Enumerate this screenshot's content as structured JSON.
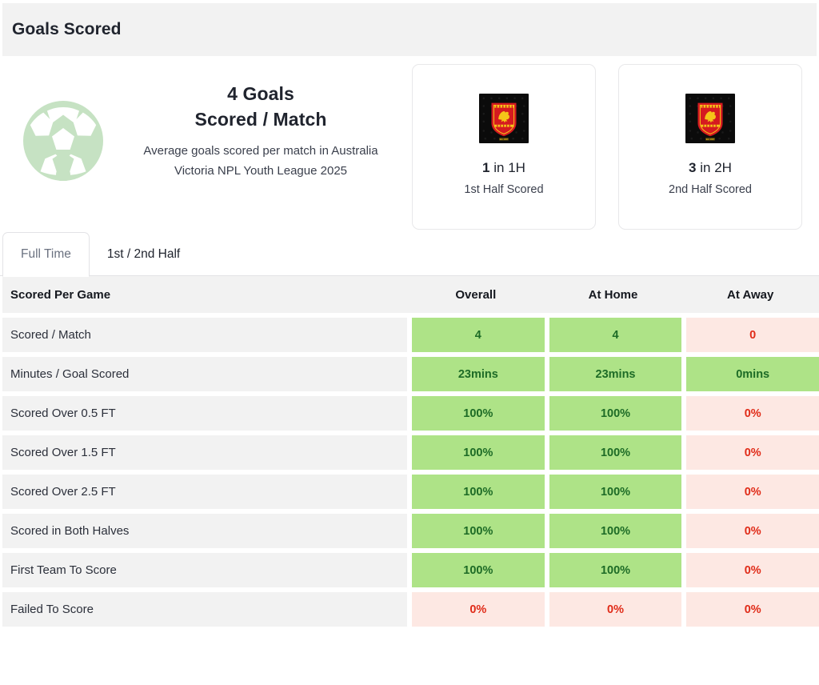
{
  "header": {
    "title": "Goals Scored"
  },
  "hero": {
    "icon": "soccer-ball-icon",
    "headline_line1": "4 Goals",
    "headline_line2": "Scored / Match",
    "description": "Average goals scored per match in Australia Victoria NPL Youth League 2025",
    "cards": [
      {
        "crest": "team-crest-icon",
        "value_number": "1",
        "value_suffix": " in 1H",
        "label": "1st Half Scored"
      },
      {
        "crest": "team-crest-icon",
        "value_number": "3",
        "value_suffix": " in 2H",
        "label": "2nd Half Scored"
      }
    ]
  },
  "tabs": {
    "items": [
      {
        "label": "Full Time",
        "active": true
      },
      {
        "label": "1st / 2nd Half",
        "active": false
      }
    ]
  },
  "table": {
    "columns": [
      "Scored Per Game",
      "Overall",
      "At Home",
      "At Away"
    ],
    "rows": [
      {
        "label": "Scored / Match",
        "values": [
          "4",
          "4",
          "0"
        ],
        "states": [
          "good",
          "good",
          "bad"
        ]
      },
      {
        "label": "Minutes / Goal Scored",
        "values": [
          "23mins",
          "23mins",
          "0mins"
        ],
        "states": [
          "good",
          "good",
          "good"
        ]
      },
      {
        "label": "Scored Over 0.5 FT",
        "values": [
          "100%",
          "100%",
          "0%"
        ],
        "states": [
          "good",
          "good",
          "bad"
        ]
      },
      {
        "label": "Scored Over 1.5 FT",
        "values": [
          "100%",
          "100%",
          "0%"
        ],
        "states": [
          "good",
          "good",
          "bad"
        ]
      },
      {
        "label": "Scored Over 2.5 FT",
        "values": [
          "100%",
          "100%",
          "0%"
        ],
        "states": [
          "good",
          "good",
          "bad"
        ]
      },
      {
        "label": "Scored in Both Halves",
        "values": [
          "100%",
          "100%",
          "0%"
        ],
        "states": [
          "good",
          "good",
          "bad"
        ]
      },
      {
        "label": "First Team To Score",
        "values": [
          "100%",
          "100%",
          "0%"
        ],
        "states": [
          "good",
          "good",
          "bad"
        ]
      },
      {
        "label": "Failed To Score",
        "values": [
          "0%",
          "0%",
          "0%"
        ],
        "states": [
          "bad",
          "bad",
          "bad"
        ]
      }
    ]
  },
  "colors": {
    "good_bg": "#aee387",
    "good_text": "#1d6b26",
    "bad_bg": "#fde8e3",
    "bad_text": "#e02b18",
    "panel_bg": "#f2f2f2",
    "ball_green": "#c6e2c3",
    "crest_red": "#d51a20",
    "crest_yellow": "#f5c518"
  }
}
